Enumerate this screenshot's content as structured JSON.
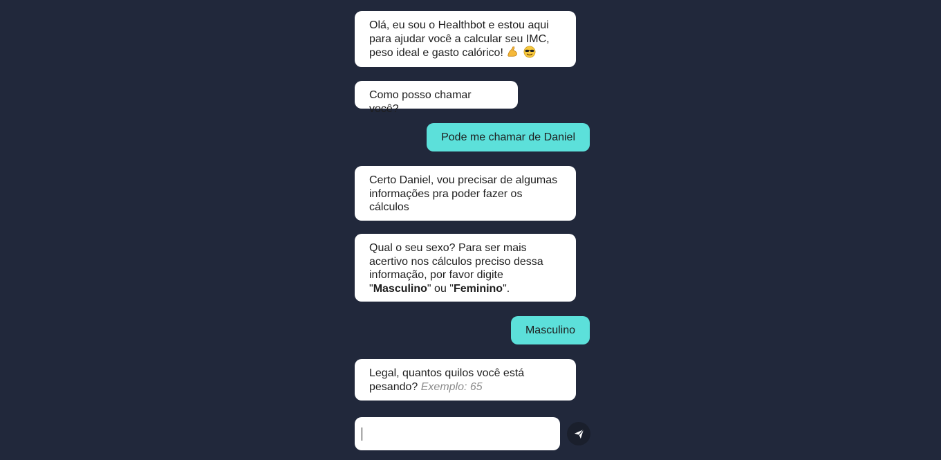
{
  "messages": {
    "bot_1": {
      "text": "Olá, eu sou o Healthbot e estou aqui para ajudar você a calcular seu IMC, peso ideal e gasto calórico!",
      "emojis": [
        "flexed-biceps-emoji",
        "smiling-face-with-sunglasses-emoji"
      ]
    },
    "bot_2": {
      "text": "Como posso chamar você?"
    },
    "user_1": {
      "text": "Pode me chamar de Daniel"
    },
    "bot_3": {
      "text": "Certo Daniel, vou precisar de algumas informações pra poder fazer os cálculos"
    },
    "bot_4": {
      "text_before": "Qual o seu sexo? Para ser mais acertivo nos cálculos preciso dessa informação, por favor digite \"",
      "option_1": "Masculino",
      "text_middle": "\" ou \"",
      "option_2": "Feminino",
      "text_after": "\"."
    },
    "user_2": {
      "text": "Masculino"
    },
    "bot_5": {
      "text": "Legal, quantos quilos você está pesando?",
      "hint": "Exemplo: 65"
    }
  },
  "composer": {
    "value": "",
    "placeholder": "",
    "send_icon": "paper-plane-icon"
  },
  "colors": {
    "background": "#21283b",
    "bot_bubble": "#ffffff",
    "user_bubble": "#5ce0da",
    "send_button": "#1a1f2c"
  }
}
